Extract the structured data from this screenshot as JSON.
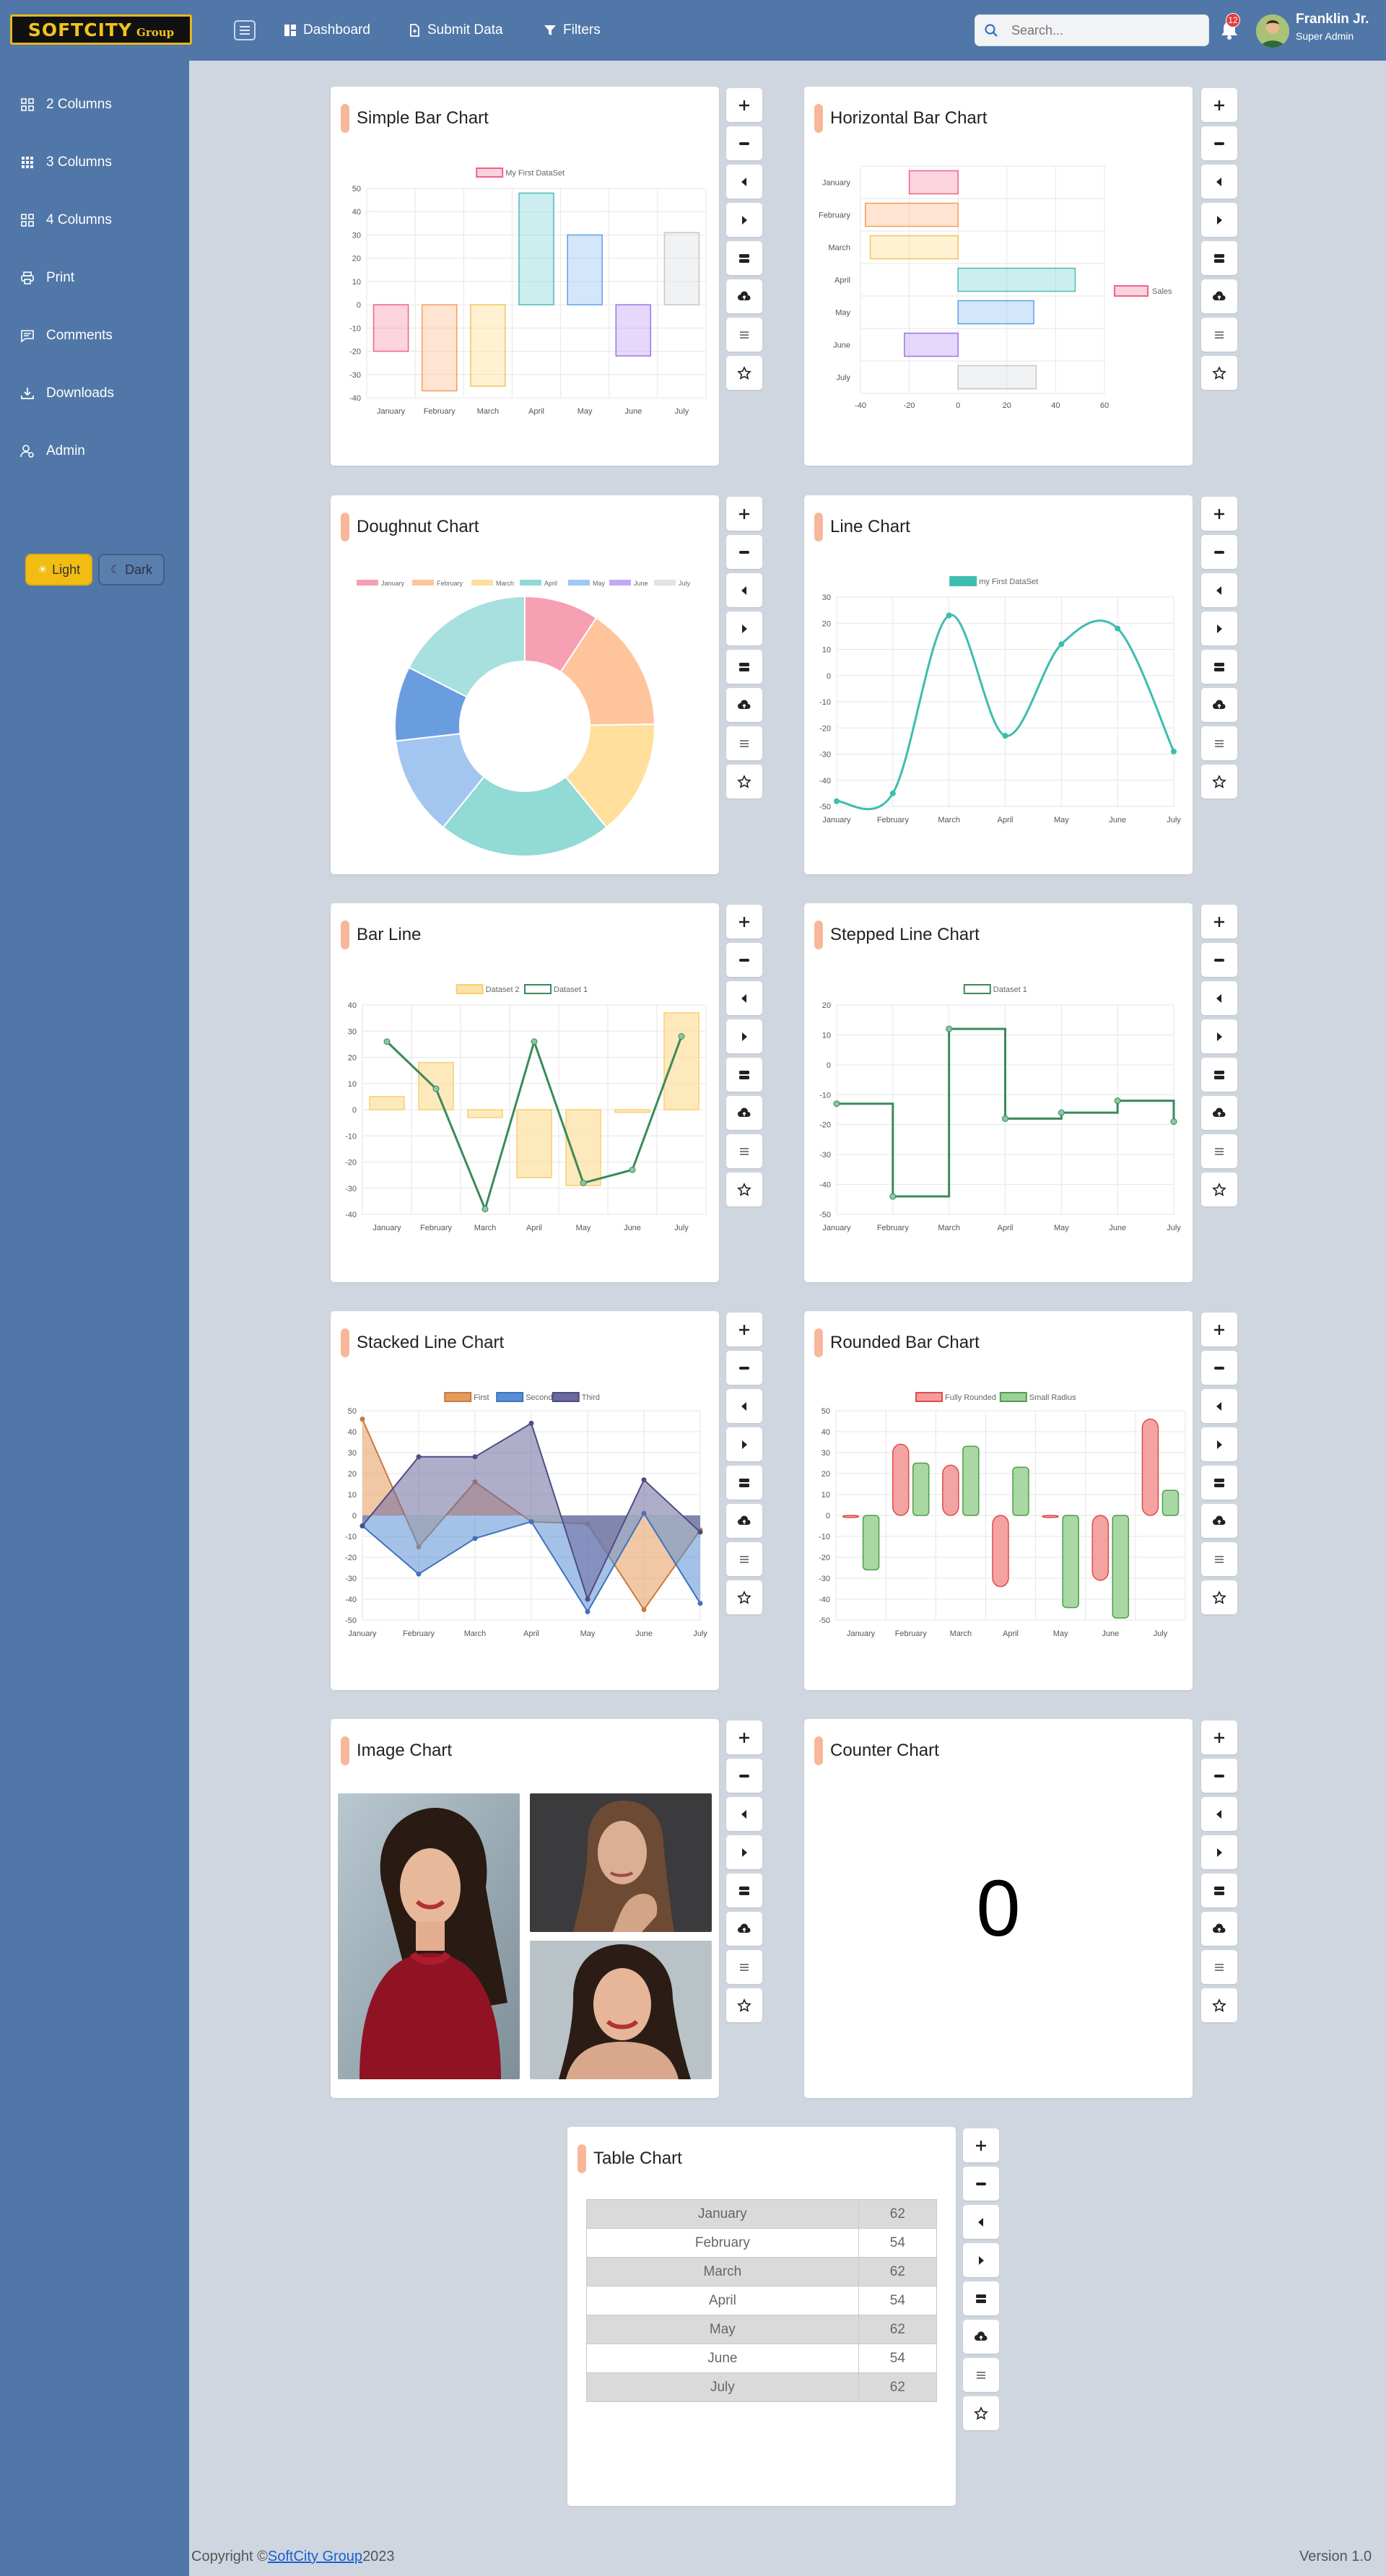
{
  "header": {
    "logo_text": "SOFTCITY",
    "logo_sub": "Group",
    "nav": [
      {
        "label": "Dashboard",
        "icon": "dashboard-icon"
      },
      {
        "label": "Submit Data",
        "icon": "file-icon"
      },
      {
        "label": "Filters",
        "icon": "filter-icon"
      }
    ],
    "search_placeholder": "Search...",
    "notification_count": "12",
    "user_name": "Franklin Jr.",
    "user_role": "Super Admin"
  },
  "sidebar": {
    "items": [
      {
        "label": "2 Columns",
        "icon": "grid-icon"
      },
      {
        "label": "3 Columns",
        "icon": "grid-icon"
      },
      {
        "label": "4 Columns",
        "icon": "grid-icon"
      },
      {
        "label": "Print",
        "icon": "printer-icon"
      },
      {
        "label": "Comments",
        "icon": "comment-icon"
      },
      {
        "label": "Downloads",
        "icon": "download-icon"
      },
      {
        "label": "Admin",
        "icon": "user-gear-icon"
      }
    ],
    "theme_light": "Light",
    "theme_dark": "Dark"
  },
  "cards": [
    {
      "title": "Simple Bar Chart"
    },
    {
      "title": "Horizontal Bar Chart"
    },
    {
      "title": "Doughnut Chart"
    },
    {
      "title": "Line Chart"
    },
    {
      "title": "Bar Line"
    },
    {
      "title": "Stepped Line Chart"
    },
    {
      "title": "Stacked Line Chart"
    },
    {
      "title": "Rounded Bar Chart"
    },
    {
      "title": "Image Chart"
    },
    {
      "title": "Counter Chart",
      "value": "0"
    },
    {
      "title": "Table Chart"
    }
  ],
  "tool_icons": [
    "plus-icon",
    "minus-icon",
    "arrow-left-icon",
    "arrow-right-icon",
    "expand-icon",
    "cloud-upload-icon",
    "list-icon",
    "star-icon"
  ],
  "colors": {
    "chrome": "#5077a8",
    "background": "#cfd6df",
    "accent": "#f8b79a",
    "light_button": "#f1bd12",
    "month_palette": [
      "#f79fb3",
      "#ffc49b",
      "#ffdf9b",
      "#8fd9d9",
      "#9fc8f3",
      "#c5a8f3",
      "#e1e2e4"
    ]
  },
  "chart_data": [
    {
      "type": "bar",
      "title": "Simple Bar Chart",
      "categories": [
        "January",
        "February",
        "March",
        "April",
        "May",
        "June",
        "July"
      ],
      "series": [
        {
          "name": "My First DataSet",
          "values": [
            -20,
            -37,
            -35,
            48,
            30,
            -22,
            31
          ]
        }
      ],
      "ylim": [
        -40,
        50
      ],
      "yticks": [
        50,
        40,
        30,
        20,
        10,
        0,
        -10,
        -20,
        -30,
        -40
      ],
      "grid": true,
      "legend": "top"
    },
    {
      "type": "bar",
      "orientation": "horizontal",
      "title": "Horizontal Bar Chart",
      "categories": [
        "January",
        "February",
        "March",
        "April",
        "May",
        "June",
        "July"
      ],
      "series": [
        {
          "name": "Sales",
          "values": [
            -20,
            -38,
            -36,
            48,
            31,
            -22,
            32
          ]
        }
      ],
      "xlim": [
        -40,
        60
      ],
      "xticks": [
        -40,
        -20,
        0,
        20,
        40,
        60
      ],
      "grid": true,
      "legend": "right"
    },
    {
      "type": "pie",
      "variant": "doughnut",
      "title": "Doughnut Chart",
      "categories": [
        "January",
        "February",
        "March",
        "April",
        "May",
        "June",
        "July"
      ],
      "values": [
        9,
        15,
        14,
        21,
        12,
        9,
        17
      ],
      "legend": "top"
    },
    {
      "type": "line",
      "title": "Line Chart",
      "categories": [
        "January",
        "February",
        "March",
        "April",
        "May",
        "June",
        "July"
      ],
      "series": [
        {
          "name": "my First DataSet",
          "values": [
            -48,
            -45,
            23,
            -23,
            12,
            18,
            -29
          ]
        }
      ],
      "ylim": [
        -50,
        30
      ],
      "yticks": [
        30,
        20,
        10,
        0,
        -10,
        -20,
        -30,
        -40,
        -50
      ],
      "grid": true,
      "legend": "top"
    },
    {
      "type": "bar",
      "title": "Bar Line",
      "categories": [
        "January",
        "February",
        "March",
        "April",
        "May",
        "June",
        "July"
      ],
      "series": [
        {
          "name": "Dataset 2",
          "kind": "bar",
          "values": [
            5,
            18,
            -3,
            -26,
            -29,
            -1,
            37
          ]
        },
        {
          "name": "Dataset 1",
          "kind": "line",
          "values": [
            26,
            8,
            -38,
            26,
            -28,
            -23,
            28
          ]
        }
      ],
      "ylim": [
        -40,
        40
      ],
      "yticks": [
        40,
        30,
        20,
        10,
        0,
        -10,
        -20,
        -30,
        -40
      ],
      "grid": true,
      "legend": "top"
    },
    {
      "type": "line",
      "variant": "stepped",
      "title": "Stepped Line Chart",
      "categories": [
        "January",
        "February",
        "March",
        "April",
        "May",
        "June",
        "July"
      ],
      "series": [
        {
          "name": "Dataset 1",
          "values": [
            -13,
            -44,
            12,
            -18,
            -16,
            -12,
            -19
          ]
        }
      ],
      "ylim": [
        -50,
        20
      ],
      "yticks": [
        20,
        10,
        0,
        -10,
        -20,
        -30,
        -40,
        -50
      ],
      "grid": true,
      "legend": "top"
    },
    {
      "type": "area",
      "title": "Stacked Line Chart",
      "categories": [
        "January",
        "February",
        "March",
        "April",
        "May",
        "June",
        "July"
      ],
      "series": [
        {
          "name": "First",
          "values": [
            46,
            -15,
            16,
            -3,
            -4,
            -45,
            -7
          ]
        },
        {
          "name": "Second",
          "values": [
            -5,
            -28,
            -11,
            -3,
            -46,
            1,
            -42
          ]
        },
        {
          "name": "Third",
          "values": [
            -5,
            28,
            28,
            44,
            -40,
            17,
            -8
          ]
        }
      ],
      "ylim": [
        -50,
        50
      ],
      "yticks": [
        50,
        40,
        30,
        20,
        10,
        0,
        -10,
        -20,
        -30,
        -40,
        -50
      ],
      "grid": true,
      "legend": "top"
    },
    {
      "type": "bar",
      "variant": "rounded",
      "title": "Rounded Bar Chart",
      "categories": [
        "January",
        "February",
        "March",
        "April",
        "May",
        "June",
        "July"
      ],
      "series": [
        {
          "name": "Fully Rounded",
          "values": [
            -1,
            34,
            24,
            -34,
            -1,
            -31,
            46
          ]
        },
        {
          "name": "Small Radius",
          "values": [
            -26,
            25,
            33,
            23,
            -44,
            -49,
            12
          ]
        }
      ],
      "ylim": [
        -50,
        50
      ],
      "yticks": [
        50,
        40,
        30,
        20,
        10,
        0,
        -10,
        -20,
        -30,
        -40,
        -50
      ],
      "grid": true,
      "legend": "top"
    },
    {
      "type": "table",
      "title": "Table Chart",
      "categories": [
        "January",
        "February",
        "March",
        "April",
        "May",
        "June",
        "July"
      ],
      "values": [
        62,
        54,
        62,
        54,
        62,
        54,
        62
      ]
    }
  ]
}
